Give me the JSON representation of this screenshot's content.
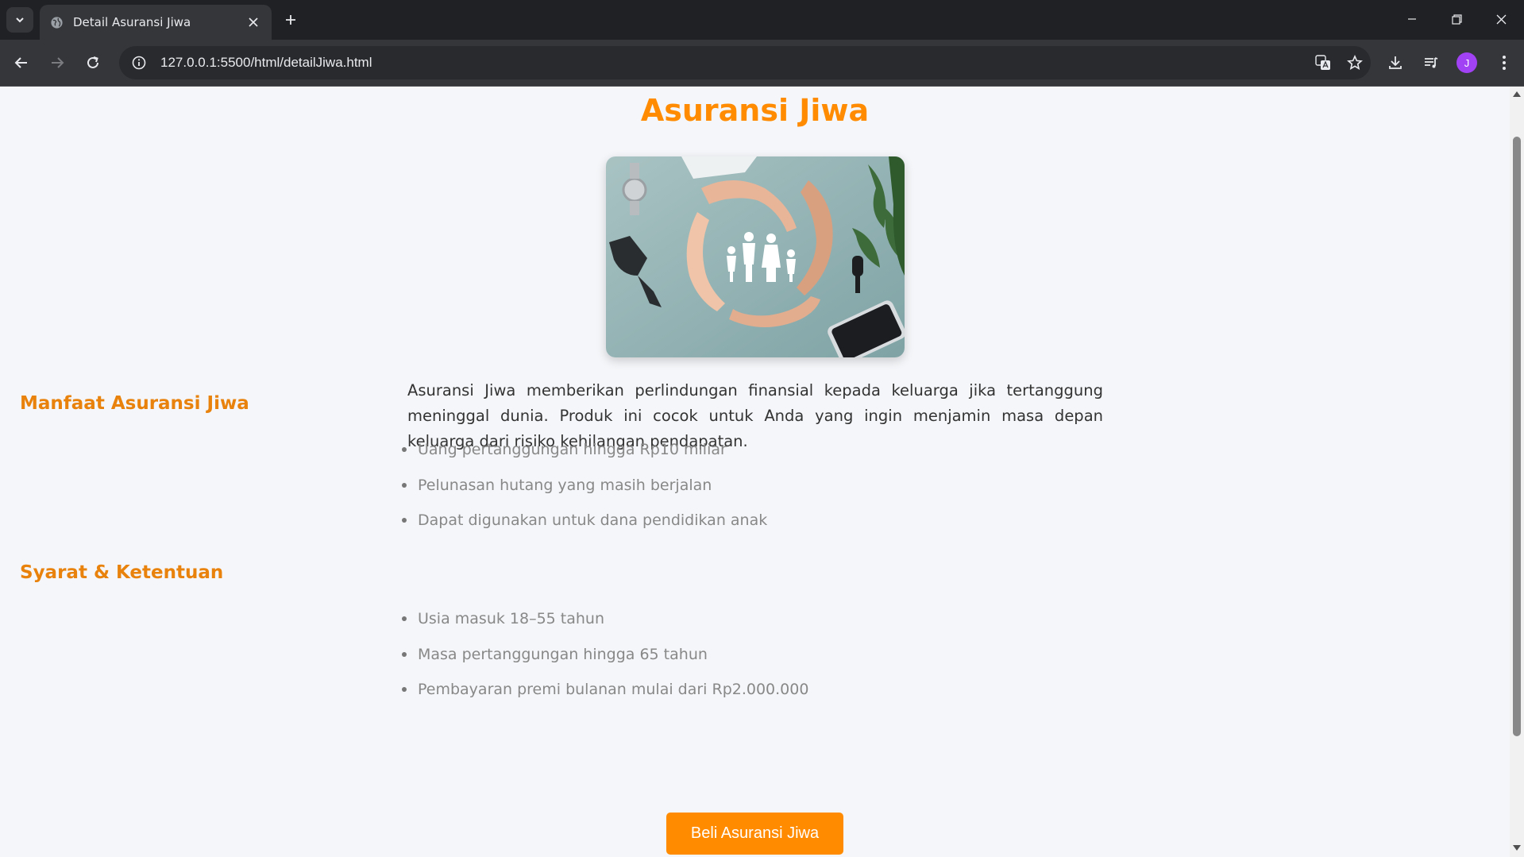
{
  "browser": {
    "tab_title": "Detail Asuransi Jiwa",
    "url": "127.0.0.1:5500/html/detailJiwa.html",
    "profile_initial": "J"
  },
  "page": {
    "title": "Asuransi Jiwa",
    "intro": "Asuransi Jiwa memberikan perlindungan finansial kepada keluarga jika tertanggung meninggal dunia. Produk ini cocok untuk Anda yang ingin menjamin masa depan keluarga dari risiko kehilangan pendapatan.",
    "benefits": {
      "heading": "Manfaat Asuransi Jiwa",
      "items": [
        "Uang pertanggungan hingga Rp10 miliar",
        "Pelunasan hutang yang masih berjalan",
        "Dapat digunakan untuk dana pendidikan anak"
      ]
    },
    "terms": {
      "heading": "Syarat & Ketentuan",
      "items": [
        "Usia masuk 18–55 tahun",
        "Masa pertanggungan hingga 65 tahun",
        "Pembayaran premi bulanan mulai dari Rp2.000.000"
      ]
    },
    "buy_button": "Beli Asuransi Jiwa"
  },
  "colors": {
    "accent": "#ff8c00",
    "heading": "#e8820c",
    "background": "#f4f6f9"
  }
}
